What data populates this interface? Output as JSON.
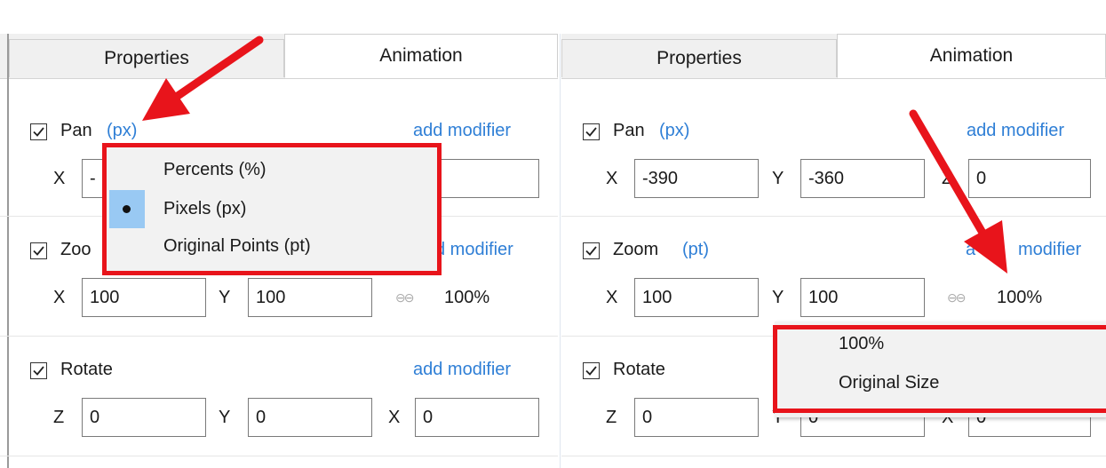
{
  "left_panel": {
    "tabs": [
      {
        "label": "Properties"
      },
      {
        "label": "Animation"
      }
    ],
    "pan": {
      "label": "Pan",
      "unit": "(px)",
      "add_modifier": "add modifier",
      "x_label": "X",
      "x_value": "-",
      "y_label": "Y",
      "y_value": "",
      "z_label": "Z",
      "z_value": ""
    },
    "zoom": {
      "label": "Zoo",
      "add_modifier": "d modifier",
      "x_label": "X",
      "x_value": "100",
      "y_label": "Y",
      "y_value": "100",
      "chain_icon": "chain-link-icon",
      "percent": "100%"
    },
    "rotate": {
      "label": "Rotate",
      "add_modifier": "add modifier",
      "z_label": "Z",
      "z_value": "0",
      "y_label": "Y",
      "y_value": "0",
      "x_label": "X",
      "x_value": "0"
    },
    "unit_menu": {
      "items": [
        {
          "label": "Percents (%)",
          "selected": false
        },
        {
          "label": "Pixels (px)",
          "selected": true
        },
        {
          "label": "Original Points (pt)",
          "selected": false
        }
      ]
    }
  },
  "right_panel": {
    "tabs": [
      {
        "label": "Properties"
      },
      {
        "label": "Animation"
      }
    ],
    "pan": {
      "label": "Pan",
      "unit": "(px)",
      "add_modifier": "add modifier",
      "x_label": "X",
      "x_value": "-390",
      "y_label": "Y",
      "y_value": "-360",
      "z_label": "Z",
      "z_value": "0"
    },
    "zoom": {
      "label": "Zoom",
      "unit": "(pt)",
      "add_modifier_a": "a",
      "add_modifier_b": "modifier",
      "x_label": "X",
      "x_value": "100",
      "y_label": "Y",
      "y_value": "100",
      "chain_icon": "chain-link-icon",
      "percent": "100%"
    },
    "rotate": {
      "label": "Rotate",
      "z_label": "Z",
      "z_value": "0",
      "y_label": "Y",
      "y_value": "0",
      "x_label": "X",
      "x_value": "0"
    },
    "zoom_menu": {
      "items": [
        {
          "label": "100%"
        },
        {
          "label": "Original Size"
        }
      ]
    }
  },
  "colors": {
    "annotation_red": "#e8141b",
    "link_blue": "#2f7fd6",
    "selected_highlight": "#99c9f3"
  }
}
